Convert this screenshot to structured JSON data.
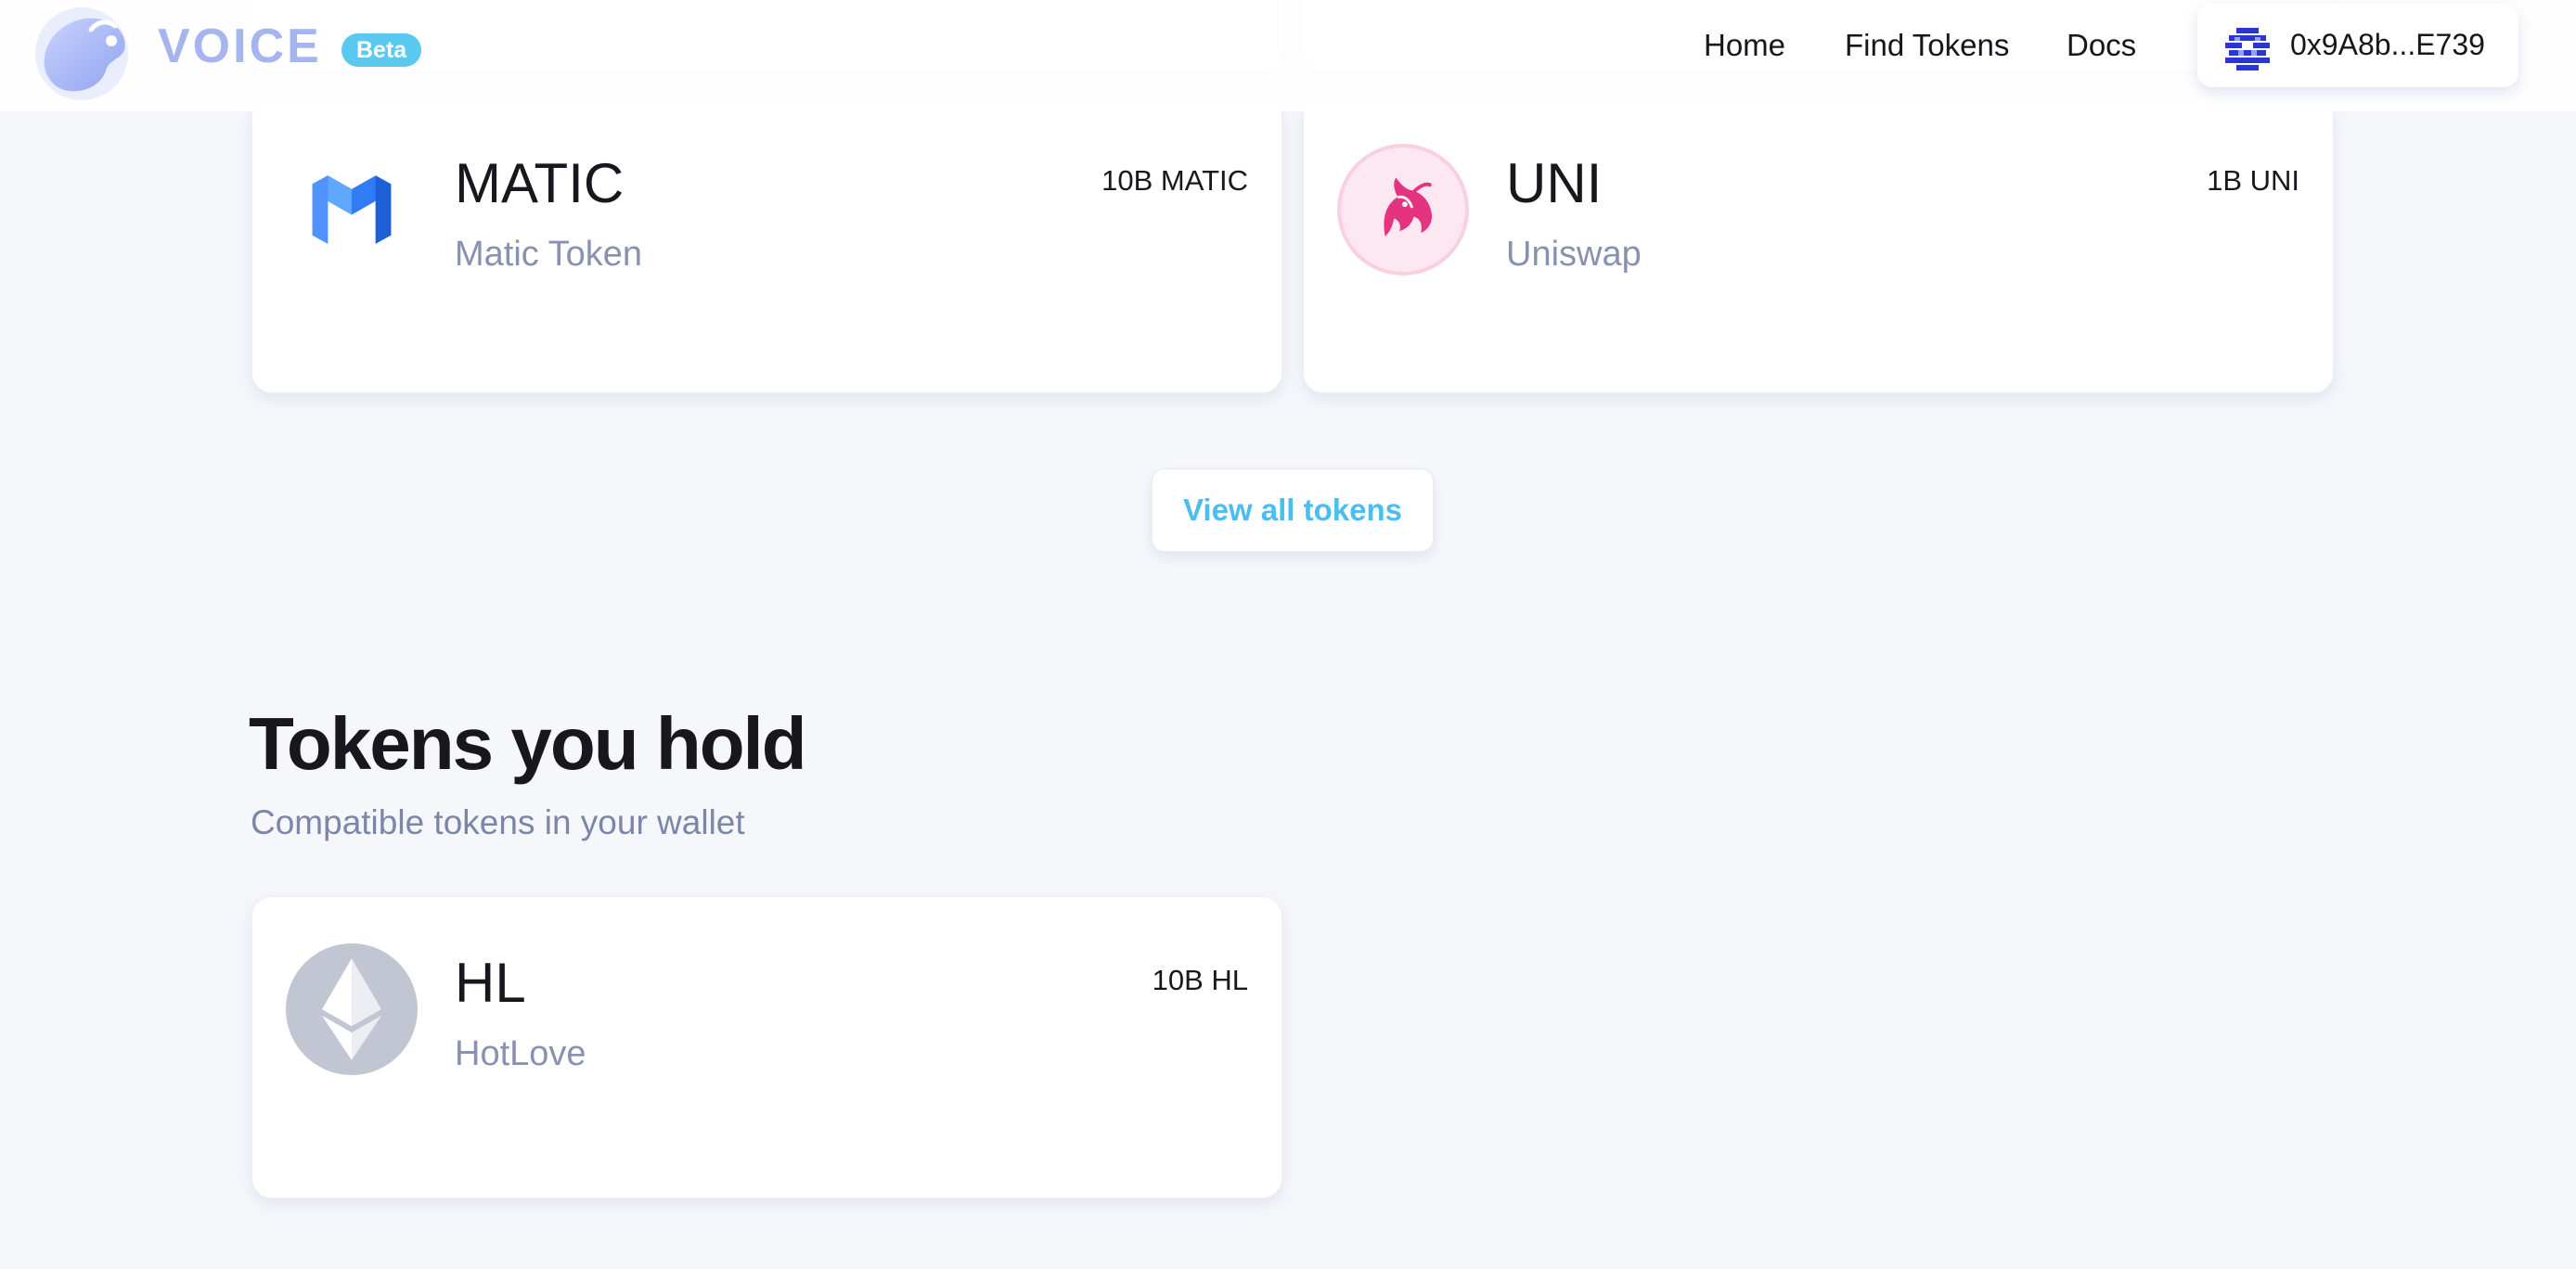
{
  "header": {
    "logo_text": "VOICE",
    "beta_label": "Beta",
    "nav": [
      {
        "label": "Home"
      },
      {
        "label": "Find Tokens"
      },
      {
        "label": "Docs"
      }
    ],
    "wallet_address": "0x9A8b...E739"
  },
  "featured_tokens": [
    {
      "symbol": "MATIC",
      "name": "Matic Token",
      "supply": "10B MATIC",
      "icon": "polygon-icon",
      "color": "#2f7cf6"
    },
    {
      "symbol": "UNI",
      "name": "Uniswap",
      "supply": "1B UNI",
      "icon": "unicorn-icon",
      "color": "#ff007a"
    }
  ],
  "view_all_label": "View all tokens",
  "held_section": {
    "title": "Tokens you hold",
    "subtitle": "Compatible tokens in your wallet",
    "tokens": [
      {
        "symbol": "HL",
        "name": "HotLove",
        "supply": "10B HL",
        "icon": "ethereum-icon"
      }
    ]
  },
  "colors": {
    "accent": "#4dbdf0",
    "badge": "#5bc8ef",
    "muted_text": "#8892b0",
    "background": "#f6f7fb"
  }
}
